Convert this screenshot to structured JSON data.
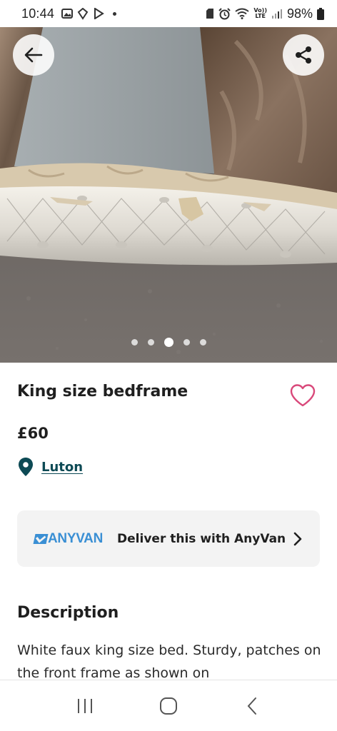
{
  "status_bar": {
    "time": "10:44",
    "battery": "98%",
    "network_badge_top": "Vo))",
    "network_badge_bottom": "LTE"
  },
  "gallery": {
    "total_images": 5,
    "active_index": 2,
    "icons": {
      "back": "arrow-left-icon",
      "share": "share-icon"
    }
  },
  "listing": {
    "title": "King size bedframe",
    "price": "£60",
    "location": "Luton",
    "favourite_icon": "heart-outline-icon"
  },
  "anyvan": {
    "logo": "ANYVAN",
    "text": "Deliver this with AnyVan"
  },
  "description": {
    "heading": "Description",
    "body": "White faux king size bed. Sturdy, patches on the front frame as shown on"
  },
  "colors": {
    "brand_link": "#0d4a55",
    "anyvan_blue": "#3a8fd4",
    "heart": "#d9487a",
    "card_bg": "#f3f3f3"
  }
}
